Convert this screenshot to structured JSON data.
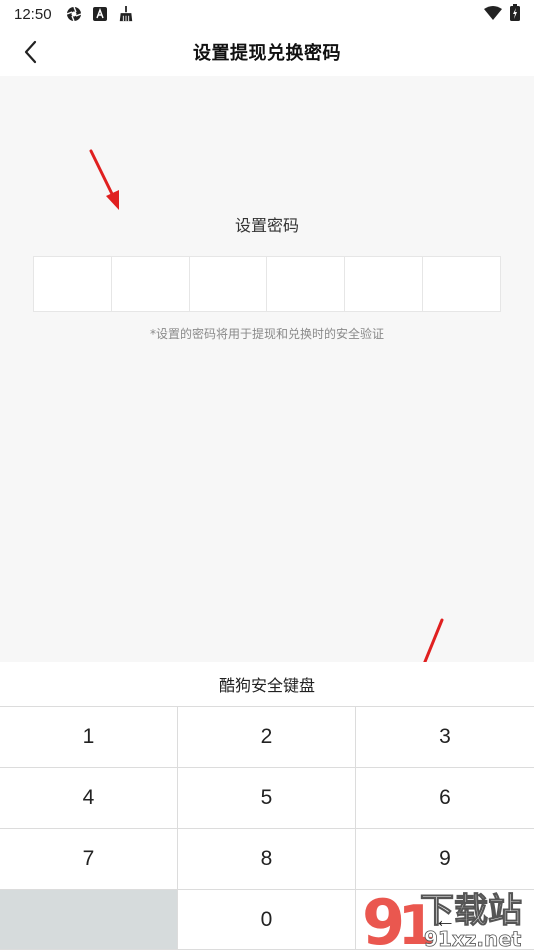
{
  "status_bar": {
    "time": "12:50",
    "left_icons": [
      "aperture-icon",
      "a-badge-icon",
      "broom-icon"
    ],
    "right_icons": [
      "wifi-icon",
      "battery-icon"
    ]
  },
  "header": {
    "title": "设置提现兑换密码",
    "back_icon": "chevron-left-icon"
  },
  "password": {
    "label": "设置密码",
    "length": 6,
    "hint": "*设置的密码将用于提现和兑换时的安全验证"
  },
  "keyboard": {
    "title": "酷狗安全键盘",
    "keys": [
      "1",
      "2",
      "3",
      "4",
      "5",
      "6",
      "7",
      "8",
      "9",
      "",
      "0",
      "←"
    ]
  },
  "watermark": {
    "text_top": "下载站",
    "text_bottom": "91xz.net",
    "logo_glyph": "9"
  },
  "colors": {
    "accent_arrow": "#e02020",
    "background": "#f7f7f7",
    "watermark_red": "#e8453c"
  }
}
